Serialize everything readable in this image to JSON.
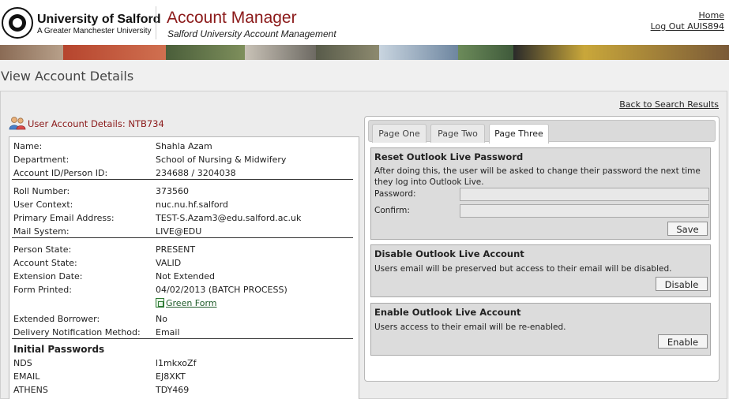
{
  "header": {
    "university_name": "University of Salford",
    "university_subtitle": "A Greater Manchester University",
    "app_title": "Account Manager",
    "app_subtitle": "Salford University Account Management",
    "home_link": "Home",
    "logout_link": "Log Out AUIS894"
  },
  "page": {
    "title": "View Account Details",
    "back_link": "Back to Search Results"
  },
  "user": {
    "heading": "User Account Details: NTB734"
  },
  "details": {
    "group1": [
      {
        "label": "Name:",
        "value": "Shahla Azam"
      },
      {
        "label": "Department:",
        "value": "School of Nursing & Midwifery"
      },
      {
        "label": "Account ID/Person ID:",
        "value": "234688 / 3204038"
      }
    ],
    "group2": [
      {
        "label": "Roll Number:",
        "value": "373560"
      },
      {
        "label": "User Context:",
        "value": "nuc.nu.hf.salford"
      },
      {
        "label": "Primary Email Address:",
        "value": "TEST-S.Azam3@edu.salford.ac.uk"
      },
      {
        "label": "Mail System:",
        "value": "LIVE@EDU"
      }
    ],
    "group3": [
      {
        "label": "Person State:",
        "value": "PRESENT"
      },
      {
        "label": "Account State:",
        "value": "VALID"
      },
      {
        "label": "Extension Date:",
        "value": "Not Extended"
      },
      {
        "label": "Form Printed:",
        "value": "04/02/2013 (BATCH PROCESS)"
      }
    ],
    "green_form_link": "Green Form",
    "group4": [
      {
        "label": "Extended Borrower:",
        "value": "No"
      },
      {
        "label": "Delivery Notification Method:",
        "value": "Email"
      }
    ],
    "initial_passwords_title": "Initial Passwords",
    "passwords": [
      {
        "label": "NDS",
        "value": "l1mkxoZf"
      },
      {
        "label": "EMAIL",
        "value": "EJ8XKT"
      },
      {
        "label": "ATHENS",
        "value": "TDY469"
      }
    ]
  },
  "tabs": [
    {
      "label": "Page One",
      "active": false
    },
    {
      "label": "Page Two",
      "active": false
    },
    {
      "label": "Page Three",
      "active": true
    }
  ],
  "reset_section": {
    "title": "Reset Outlook Live Password",
    "description": "After doing this, the user will be asked to change their password the next time they log into Outlook Live.",
    "password_label": "Password:",
    "password_value": "",
    "confirm_label": "Confirm:",
    "confirm_value": "",
    "button": "Save"
  },
  "disable_section": {
    "title": "Disable Outlook Live Account",
    "description": "Users email will be preserved but access to their email will be disabled.",
    "button": "Disable"
  },
  "enable_section": {
    "title": "Enable Outlook Live Account",
    "description": "Users access to their email will be re-enabled.",
    "button": "Enable"
  },
  "colors": {
    "brand_red": "#8b1a1a",
    "section_bg": "#dcdcdc"
  },
  "icons": {
    "logo": "university-seal-icon",
    "user_heading": "users-icon",
    "green_form": "document-icon"
  }
}
